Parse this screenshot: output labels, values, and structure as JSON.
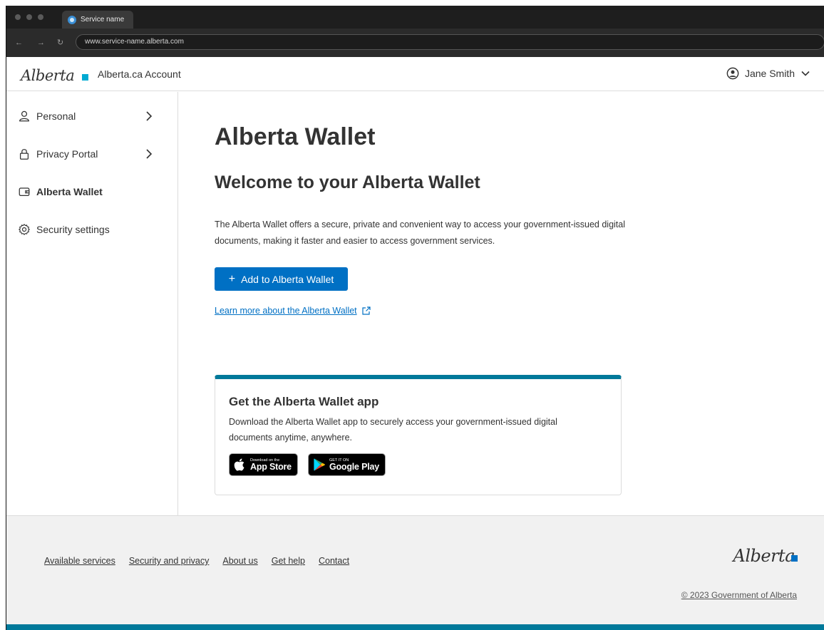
{
  "browser": {
    "tab_title": "Service name",
    "url": "www.service-name.alberta.com",
    "back_glyph": "←",
    "forward_glyph": "→",
    "reload_glyph": "↻"
  },
  "header": {
    "logo_text": "Alberta",
    "app_title": "Alberta.ca Account",
    "user_name": "Jane Smith"
  },
  "sidebar": {
    "items": [
      {
        "label": "Personal",
        "icon": "person-icon",
        "has_chevron": true,
        "active": false
      },
      {
        "label": "Privacy Portal",
        "icon": "lock-icon",
        "has_chevron": true,
        "active": false
      },
      {
        "label": "Alberta Wallet",
        "icon": "wallet-icon",
        "has_chevron": false,
        "active": true
      },
      {
        "label": "Security settings",
        "icon": "gear-icon",
        "has_chevron": false,
        "active": false
      }
    ]
  },
  "main": {
    "title": "Alberta Wallet",
    "subtitle": "Welcome to your Alberta Wallet",
    "intro": "The Alberta Wallet offers a secure, private and convenient way to access your government-issued digital documents, making it faster and easier to access government services.",
    "add_button_plus": "+",
    "add_button_label": "Add to Alberta Wallet",
    "learn_more_link": "Learn more about the Alberta Wallet",
    "card": {
      "title": "Get the Alberta Wallet app",
      "text": "Download the Alberta Wallet app to securely access your government-issued digital documents anytime, anywhere.",
      "app_store": {
        "small": "Download on the",
        "big": "App Store"
      },
      "google_play": {
        "small": "GET IT ON",
        "big": "Google Play"
      }
    }
  },
  "footer": {
    "links": [
      "Available services",
      "Security and privacy",
      "About us",
      "Get help",
      "Contact"
    ],
    "logo_text": "Alberta",
    "copyright": "© 2023 Government of Alberta"
  },
  "colors": {
    "primary": "#0070c4",
    "accent_teal": "#00799a",
    "logo_square": "#00aad2",
    "text": "#333333",
    "footer_bg": "#f1f1f1"
  }
}
